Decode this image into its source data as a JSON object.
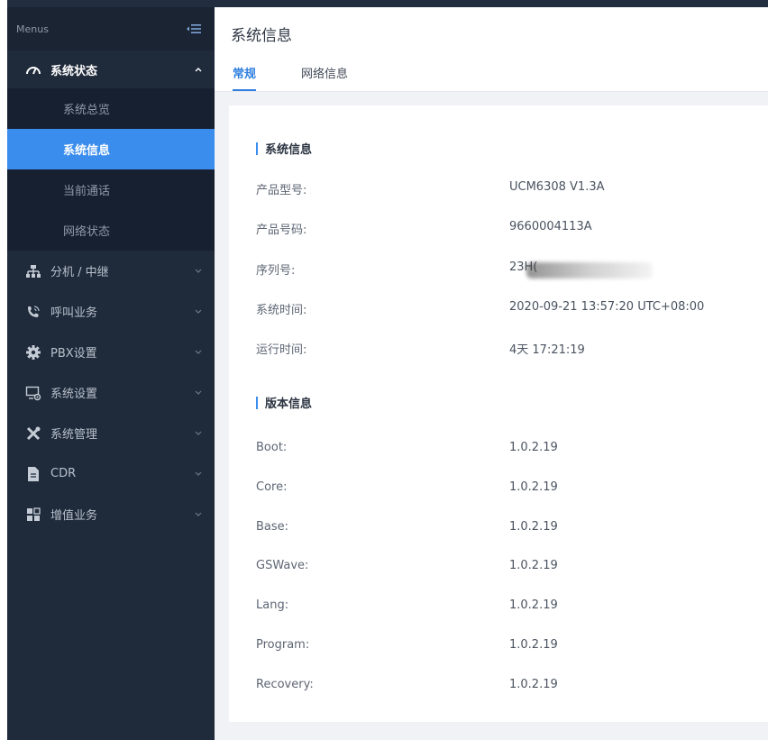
{
  "sidebar": {
    "header": "Menus",
    "group_status": "系统状态",
    "sub_overview": "系统总览",
    "sub_sysinfo": "系统信息",
    "sub_calls": "当前通话",
    "sub_network": "网络状态",
    "items": [
      {
        "label": "分机 / 中继",
        "icon": "extension-trunk-icon"
      },
      {
        "label": "呼叫业务",
        "icon": "call-features-icon"
      },
      {
        "label": "PBX设置",
        "icon": "gear-icon"
      },
      {
        "label": "系统设置",
        "icon": "system-settings-icon"
      },
      {
        "label": "系统管理",
        "icon": "tools-icon"
      },
      {
        "label": "CDR",
        "icon": "document-icon"
      },
      {
        "label": "增值业务",
        "icon": "value-added-icon"
      }
    ]
  },
  "page": {
    "title": "系统信息",
    "tabs": [
      "常规",
      "网络信息"
    ]
  },
  "system_info": {
    "title": "系统信息",
    "rows": [
      {
        "label": "产品型号:",
        "value": "UCM6308 V1.3A"
      },
      {
        "label": "产品号码:",
        "value": "9660004113A"
      },
      {
        "label": "序列号:",
        "value": "23H("
      },
      {
        "label": "系统时间:",
        "value": "2020-09-21 13:57:20 UTC+08:00"
      },
      {
        "label": "运行时间:",
        "value": "4天 17:21:19"
      }
    ]
  },
  "version_info": {
    "title": "版本信息",
    "rows": [
      {
        "label": "Boot:",
        "value": "1.0.2.19"
      },
      {
        "label": "Core:",
        "value": "1.0.2.19"
      },
      {
        "label": "Base:",
        "value": "1.0.2.19"
      },
      {
        "label": "GSWave:",
        "value": "1.0.2.19"
      },
      {
        "label": "Lang:",
        "value": "1.0.2.19"
      },
      {
        "label": "Program:",
        "value": "1.0.2.19"
      },
      {
        "label": "Recovery:",
        "value": "1.0.2.19"
      }
    ]
  },
  "colors": {
    "sidebar_bg": "#1f2a3a",
    "active_item": "#3b8ded",
    "tab_active": "#2f7fe0"
  }
}
